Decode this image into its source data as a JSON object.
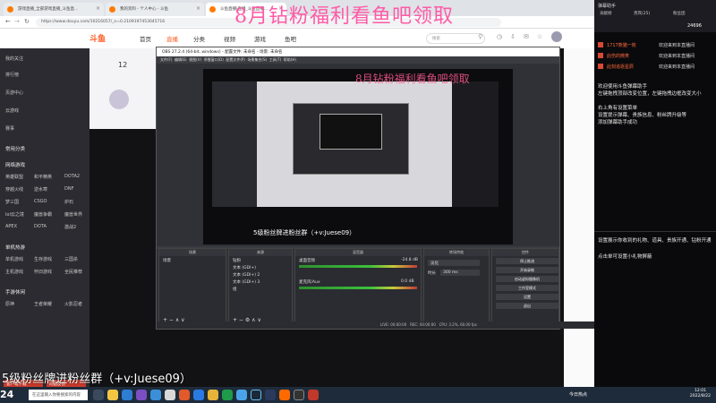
{
  "browser": {
    "tabs": [
      {
        "label": "游戏直播_全部游戏直播_斗鱼直...",
        "active": false
      },
      {
        "label": "我的资料 - 个人中心 - 斗鱼",
        "active": false
      },
      {
        "label": "斗鱼直播|直播_斗鱼直播...",
        "active": true
      }
    ],
    "url": "https://www.douyu.com/10216057/_n=0.2109197453045716"
  },
  "top_watermark": "8月钻粉福利看鱼吧领取",
  "site": {
    "logo": "斗鱼",
    "nav": [
      "首页",
      "直播",
      "分类",
      "视频",
      "游戏",
      "鱼吧"
    ],
    "search_placeholder": "搜索",
    "sidebar": {
      "items": [
        "我的关注",
        "排行榜",
        "页游中心",
        "云游戏",
        "赛事"
      ],
      "section_common": "常用分类",
      "section_online": "网络游戏",
      "section_mobile": "单机热游",
      "section_hand": "手游休闲",
      "grid": [
        "英雄联盟",
        "和平精英",
        "DOTA2",
        "穿越火线",
        "逆水寒",
        "DNF",
        "梦三国",
        "CSGO",
        "炉石",
        "lol云之境",
        "魔兽争霸",
        "魔兽世界",
        "APEX",
        "DOTA",
        "激战2",
        "单机游戏",
        "生存游戏",
        "三国杀",
        "主机游戏",
        "怀旧游戏",
        "全民推荐",
        "原神",
        "王者荣耀",
        "火影忍者"
      ],
      "buttons": [
        "客户端下载",
        "问题反馈"
      ]
    },
    "room_level": "12"
  },
  "obs": {
    "title": "OBS 27.2.4 (64-bit, windows) - 配置文件: 未命名 - 场景: 未命名",
    "menu": [
      "文件(F)",
      "编辑(E)",
      "视图(V)",
      "停靠窗口(D)",
      "配置文件(P)",
      "场景集合(S)",
      "工具(T)",
      "帮助(H)"
    ],
    "preview_watermark": "8月钻粉福利看鱼吧领取",
    "preview_caption": "5级粉丝牌进粉丝群（+v:Juese09）",
    "sources_label": "未选择源",
    "docks": {
      "scenes": {
        "title": "场景",
        "items": [
          "场景"
        ]
      },
      "sources": {
        "title": "来源",
        "items": [
          "钻粉",
          "文本 (GDI+)",
          "文本 (GDI+) 2",
          "文本 (GDI+) 3",
          "组"
        ]
      },
      "mixer": {
        "title": "混音器",
        "tracks": [
          {
            "name": "桌面音频",
            "db": "-24.8 dB"
          },
          {
            "name": "麦克风/Aux",
            "db": "0.0 dB"
          }
        ]
      },
      "transitions": {
        "title": "转场特效",
        "value": "淡化",
        "duration_label": "时长",
        "duration": "300 ms"
      },
      "controls": {
        "title": "控件",
        "buttons": [
          "停止推流",
          "开始录制",
          "启动虚拟摄像机",
          "工作室模式",
          "设置",
          "退出"
        ]
      }
    },
    "status": {
      "live": "LIVE: 00:00:00",
      "rec": "REC: 00:00:00",
      "cpu": "CPU: 3.2%, 60.00 fps"
    }
  },
  "bottom_caption": "5级粉丝牌进粉丝群（+v:Juese09）",
  "chat": {
    "header": "弹幕助手",
    "tabs": [
      "贡献榜",
      "贵宾(25)",
      "粉丝团"
    ],
    "count": "24696",
    "lines": [
      {
        "user": "1717熊猫一枚",
        "text": "欢迎来到本直播间"
      },
      {
        "user": "此伤的微笑",
        "text": "欢迎来到本直播间"
      },
      {
        "user": "此刻追逐星辰",
        "text": "欢迎来到本直播间"
      }
    ],
    "messages": [
      "欢迎使用斗鱼弹幕助手",
      "左键拖拽顶部改变位置，左键拖拽边框改变大小",
      "右上角有设置菜单",
      "设置提示弹幕、贵族信息、粉丝牌升级等",
      "添加弹幕助手成功"
    ],
    "gift_messages": [
      "设置展示你收到的礼物、道具、贵族开通、钻粉开通",
      "点击单可设置小礼物屏蔽"
    ]
  },
  "taskbar": {
    "search_placeholder": "在这里输入你要搜索的内容",
    "news": "今日热点",
    "time": "12:01",
    "date": "2022/8/22",
    "counter": "24"
  }
}
